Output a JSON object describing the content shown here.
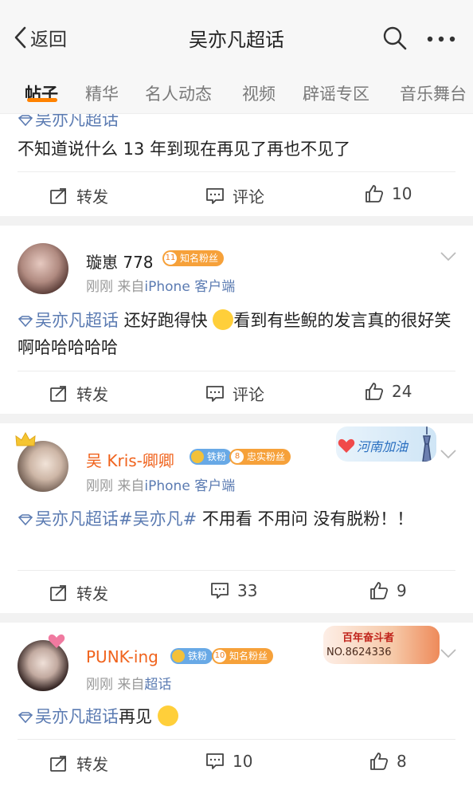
{
  "header": {
    "back_label": "返回",
    "title": "吴亦凡超话"
  },
  "tabs": [
    "帖子",
    "精华",
    "名人动态",
    "视频",
    "辟谣专区",
    "音乐舞台"
  ],
  "posts": [
    {
      "topic": "吴亦凡超话",
      "text": "不知道说什么 13 年到现在再见了再也不见了",
      "actions": {
        "repost": "转发",
        "comment": "评论",
        "likes": "10"
      }
    },
    {
      "username": "璇崽 778",
      "badges": [
        {
          "level": "11",
          "label": "知名粉丝"
        }
      ],
      "time": "刚刚",
      "source_prefix": "来自",
      "source": "iPhone 客户端",
      "topic": "吴亦凡超话",
      "text_a": " 还好跑得快 ",
      "text_b": "看到有些鲵的发言真的很好笑啊哈哈哈哈哈",
      "actions": {
        "repost": "转发",
        "comment": "评论",
        "likes": "24"
      }
    },
    {
      "username": "吴 Kris-卿卿",
      "badges": [
        {
          "label": "铁粉"
        },
        {
          "level": "8",
          "label": "忠实粉丝"
        }
      ],
      "time": "刚刚",
      "source_prefix": "来自",
      "source": "iPhone 客户端",
      "decoration_text": "河南加油",
      "topic": "吴亦凡超话#吴亦凡#",
      "text": " 不用看 不用问 没有脱粉！！",
      "actions": {
        "repost": "转发",
        "comments": "33",
        "likes": "9"
      }
    },
    {
      "username": "PUNK-ing",
      "badges": [
        {
          "label": "铁粉"
        },
        {
          "level": "10",
          "label": "知名粉丝"
        }
      ],
      "time": "刚刚",
      "source_prefix": "来自",
      "source": "超话",
      "decoration_title": "百年奋斗者",
      "decoration_no": "NO.8624336",
      "topic": "吴亦凡超话",
      "text": "再见 ",
      "actions": {
        "repost": "转发",
        "comments": "10",
        "likes": "8"
      }
    }
  ],
  "colors": {
    "accent": "#ff8200",
    "link": "#5b7bb2",
    "vip_name": "#f0631d",
    "fan_badge": "#f6a13a",
    "iron_badge": "#68a9e6"
  }
}
